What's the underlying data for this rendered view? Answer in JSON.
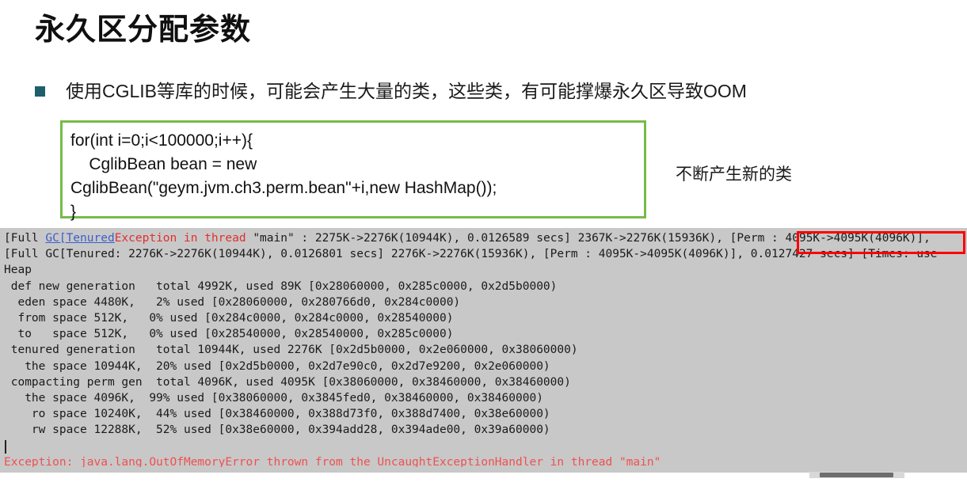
{
  "slide": {
    "title": "永久区分配参数",
    "bullet": {
      "marker_color": "#1f5f6b",
      "text": "使用CGLIB等库的时候，可能会产生大量的类，这些类，有可能撑爆永久区导致OOM"
    },
    "code_box": {
      "border_color": "#76bb4a",
      "code": "for(int i=0;i<100000;i++){\n    CglibBean bean = new\nCglibBean(\"geym.jvm.ch3.perm.bean\"+i,new HashMap());\n}"
    },
    "annotation": "不断产生新的类"
  },
  "console": {
    "background_color": "#c8c8c8",
    "link_color": "#3a5fcd",
    "error_color": "#f05050",
    "highlight_color": "#ff0000",
    "lines": [
      {
        "id": "gc-line-1",
        "segments": [
          {
            "text": "[Full ",
            "style": "plain"
          },
          {
            "text": "GC[Tenured",
            "style": "link"
          },
          {
            "text": "Exception in thread ",
            "style": "red"
          },
          {
            "text": "\"main\"",
            "style": "plain"
          },
          {
            "text": " : 2275K->2276K(10944K), 0.0126589 secs] 2367K->2276K(15936K), [Perm : 4095K->4095K(4096K)],",
            "style": "plain"
          }
        ]
      },
      {
        "id": "gc-line-2",
        "text": "[Full GC[Tenured: 2276K->2276K(10944K), 0.0126801 secs] 2276K->2276K(15936K), [Perm : 4095K->4095K(4096K)], 0.0127427 secs] [Times: use"
      },
      {
        "id": "heap-header",
        "text": "Heap"
      },
      {
        "id": "def-new-generation",
        "text": " def new generation   total 4992K, used 89K [0x28060000, 0x285c0000, 0x2d5b0000)"
      },
      {
        "id": "eden-space",
        "text": "  eden space 4480K,   2% used [0x28060000, 0x280766d0, 0x284c0000)"
      },
      {
        "id": "from-space",
        "text": "  from space 512K,   0% used [0x284c0000, 0x284c0000, 0x28540000)"
      },
      {
        "id": "to-space",
        "text": "  to   space 512K,   0% used [0x28540000, 0x28540000, 0x285c0000)"
      },
      {
        "id": "tenured-generation",
        "text": " tenured generation   total 10944K, used 2276K [0x2d5b0000, 0x2e060000, 0x38060000)"
      },
      {
        "id": "tenured-the-space",
        "text": "   the space 10944K,  20% used [0x2d5b0000, 0x2d7e90c0, 0x2d7e9200, 0x2e060000)"
      },
      {
        "id": "compacting-perm-gen",
        "text": " compacting perm gen  total 4096K, used 4095K [0x38060000, 0x38460000, 0x38460000)"
      },
      {
        "id": "perm-the-space",
        "text": "   the space 4096K,  99% used [0x38060000, 0x3845fed0, 0x38460000, 0x38460000)"
      },
      {
        "id": "ro-space",
        "text": "    ro space 10240K,  44% used [0x38460000, 0x388d73f0, 0x388d7400, 0x38e60000)"
      },
      {
        "id": "rw-space",
        "text": "    rw space 12288K,  52% used [0x38e60000, 0x394add28, 0x394ade00, 0x39a60000)"
      },
      {
        "id": "blank-line",
        "text": ""
      },
      {
        "id": "exception-line",
        "style": "error",
        "text": "Exception: java.lang.OutOfMemoryError thrown from the UncaughtExceptionHandler in thread \"main\""
      }
    ]
  }
}
